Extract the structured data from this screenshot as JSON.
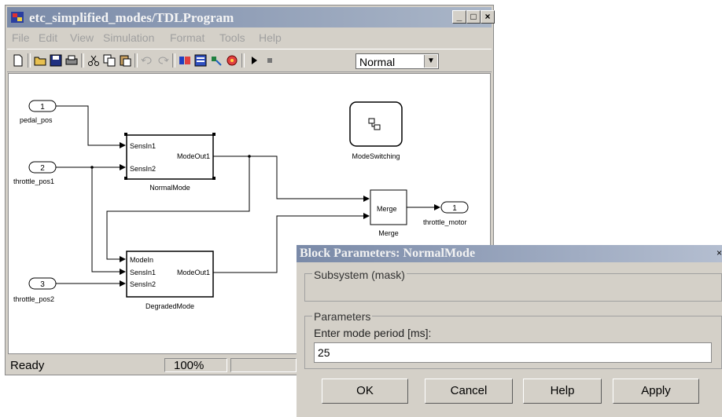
{
  "window": {
    "title": "etc_simplified_modes/TDLProgram",
    "controls": {
      "minimize": "_",
      "maximize": "□",
      "close": "×"
    }
  },
  "menu": [
    "File",
    "Edit",
    "View",
    "Simulation",
    "Format",
    "Tools",
    "Help"
  ],
  "toolbar": {
    "icons": [
      "new-icon",
      "open-icon",
      "save-icon",
      "print-icon",
      "cut-icon",
      "copy-icon",
      "paste-icon",
      "undo-icon",
      "redo-icon",
      "library-browser-icon",
      "model-explorer-icon",
      "debugger-icon",
      "record-icon",
      "play-icon",
      "stop-icon"
    ],
    "sim_mode": "Normal"
  },
  "diagram": {
    "inports": [
      {
        "number": "1",
        "label": "pedal_pos"
      },
      {
        "number": "2",
        "label": "throttle_pos1"
      },
      {
        "number": "3",
        "label": "throttle_pos2"
      }
    ],
    "outport": {
      "number": "1",
      "label": "throttle_motor"
    },
    "normal_mode": {
      "name": "NormalMode",
      "in1": "SensIn1",
      "in2": "SensIn2",
      "out": "ModeOut1"
    },
    "degraded_mode": {
      "name": "DegradedMode",
      "in0": "ModeIn",
      "in1": "SensIn1",
      "in2": "SensIn2",
      "out": "ModeOut1"
    },
    "mode_switching": {
      "name": "ModeSwitching"
    },
    "merge": {
      "name": "Merge",
      "inner": "Merge"
    }
  },
  "status": {
    "text": "Ready",
    "zoom": "100%"
  },
  "dialog": {
    "title": "Block Parameters: NormalMode",
    "close": "×",
    "subsystem_group": "Subsystem (mask)",
    "params_group": "Parameters",
    "field_label": "Enter mode period [ms]:",
    "field_value": "25",
    "buttons": {
      "ok": "OK",
      "cancel": "Cancel",
      "help": "Help",
      "apply": "Apply"
    }
  }
}
